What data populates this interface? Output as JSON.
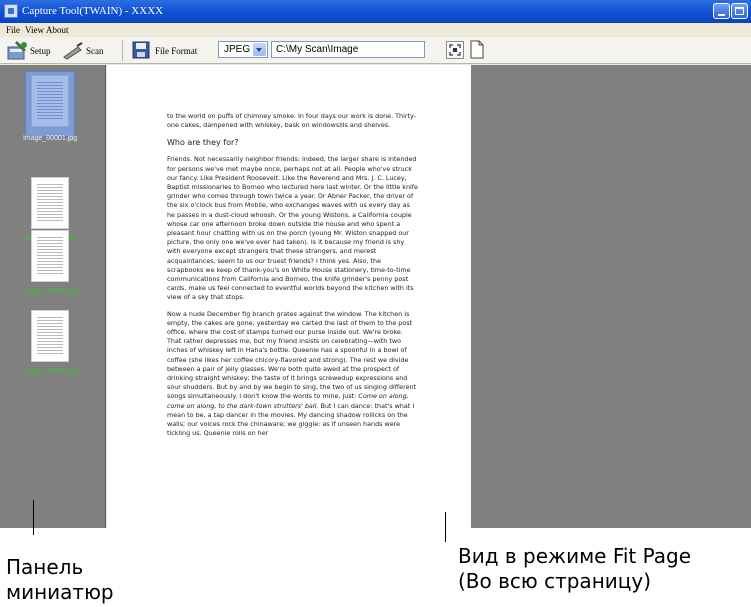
{
  "window": {
    "title": "Capture Tool(TWAIN) -  XXXX",
    "menu": [
      "File",
      "View",
      "About"
    ]
  },
  "toolbar": {
    "setup_label": "Setup",
    "scan_label": "Scan",
    "file_format_label": "File Format",
    "format_value": "JPEG",
    "path_value": "C:\\My Scan\\Image"
  },
  "thumbnails": [
    {
      "caption": "Image_00001.jpg",
      "selected": true
    },
    {
      "caption": "Image_00002.jpg",
      "selected": false
    },
    {
      "caption": "Image_00003.jpg",
      "selected": false
    },
    {
      "caption": "Image_00004.jpg",
      "selected": false
    }
  ],
  "document": {
    "intro": "to the world on puffs of chimney smoke. In four days our work is done. Thirty-one cakes, dampened with whiskey, bask on windowsills and shelves.",
    "heading": "Who are they for?",
    "para1": "Friends. Not necessarily neighbor friends: indeed, the larger share is intended for persons we've met maybe once, perhaps not at all. People who've struck our fancy. Like President Roosevelt. Like the Reverend and Mrs. J. C. Lucey, Baptist missionaries to Borneo who lectured here last winter. Or the little knife grinder who comes through town twice a year. Or Abner Packer, the driver of the six o'clock bus from Mobile, who exchanges waves with us every day as he passes in a dust-cloud whoosh. Or the young Wistons, a California couple whose car one afternoon broke down outside the house and who spent a pleasant hour chatting with us on the porch (young Mr. Wiston snapped our picture, the only one we've ever had taken). Is it because my friend is shy with everyone except strangers that these strangers, and merest acquaintances, seem to us our truest friends? I think yes. Also, the scrapbooks we keep of thank-you's on White House stationery, time-to-time communications from California and Borneo, the knife grinder's penny post cards, make us feel connected to eventful worlds beyond the kitchen with its view of a sky that stops.",
    "para2": "Now a nude December fig branch grates against the window. The kitchen is empty, the cakes are gone; yesterday we carted the last of them to the post office, where the cost of stamps turned our purse inside out. We're broke. That rather depresses me, but my friend insists on celebrating—with two inches of whiskey left in Haha's bottle. Queenie has a spoonful in a bowl of coffee (she likes her coffee chicory-flavored and strong). The rest we divide between a pair of jelly glasses. We're both quite awed at the prospect of drinking straight whiskey; the taste of it brings screwedup expressions and sour shudders. But by and by we begin to sing, the two of us singing different songs simultaneously. I don't know the words to mine, just:",
    "para2_italic": "Come on along, come on along, to the dark-town strutters' ball.",
    "para2_end": " But I can dance: that's what I mean to be, a tap dancer in the movies. My dancing shadow rollicks on the walls; our voices rock the chinaware; we giggle: as if unseen hands were tickling us. Queenie rolls on her"
  },
  "annotations": {
    "thumbnail_panel": "Панель\nминиатюр",
    "fit_page_view": "Вид в режиме Fit Page\n(Во всю страницу)"
  }
}
